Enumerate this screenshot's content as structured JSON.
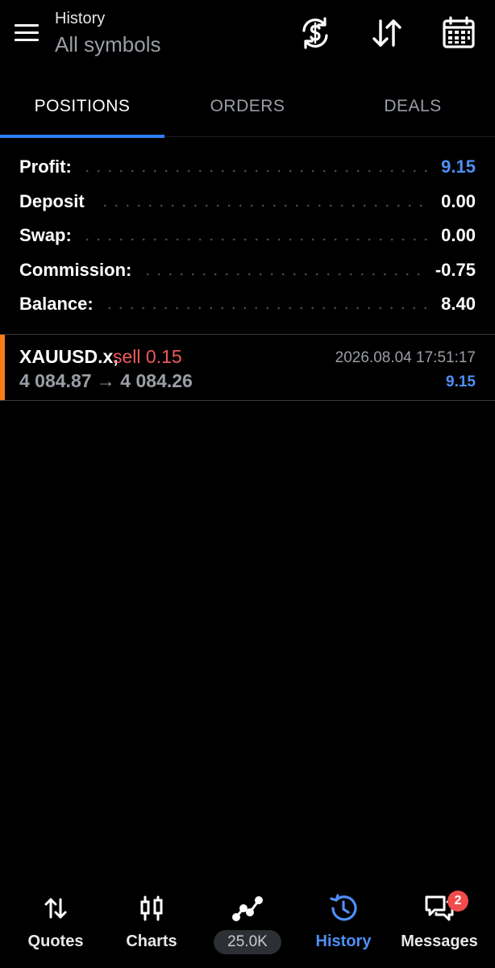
{
  "header": {
    "title": "History",
    "subtitle": "All symbols",
    "icons": [
      "hamburger-menu-icon",
      "currency-sync-icon",
      "sort-arrows-icon",
      "calendar-icon"
    ]
  },
  "tabs": [
    {
      "label": "POSITIONS",
      "active": true
    },
    {
      "label": "ORDERS",
      "active": false
    },
    {
      "label": "DEALS",
      "active": false
    }
  ],
  "summary": [
    {
      "label": "Profit:",
      "value": "9.15"
    },
    {
      "label": "Deposit",
      "value": "0.00"
    },
    {
      "label": "Swap:",
      "value": "0.00"
    },
    {
      "label": "Commission:",
      "value": "-0.75"
    },
    {
      "label": "Balance:",
      "value": "8.40"
    }
  ],
  "deals": [
    {
      "symbol": "XAUUSD.x,",
      "side": "sell 0.15",
      "prices": "4 084.87 → 4 084.26",
      "time": "2026.08.04 17:51:17",
      "profit": "9.15"
    }
  ],
  "nav": [
    {
      "label": "Quotes",
      "icon": "quotes-arrows-icon"
    },
    {
      "label": "Charts",
      "icon": "candlestick-icon"
    },
    {
      "label": "25.0K",
      "icon": "trade-line-icon"
    },
    {
      "label": "History",
      "icon": "history-clock-icon",
      "active": true
    },
    {
      "label": "Messages",
      "icon": "messages-chat-icon",
      "badge": "2"
    }
  ],
  "colors": {
    "accent": "#2d7ff9",
    "profit_blue": "#4f8ff7",
    "sell_red": "#ef5a5a",
    "deal_marker": "#ff7a1a",
    "badge": "#ef4c4c"
  }
}
